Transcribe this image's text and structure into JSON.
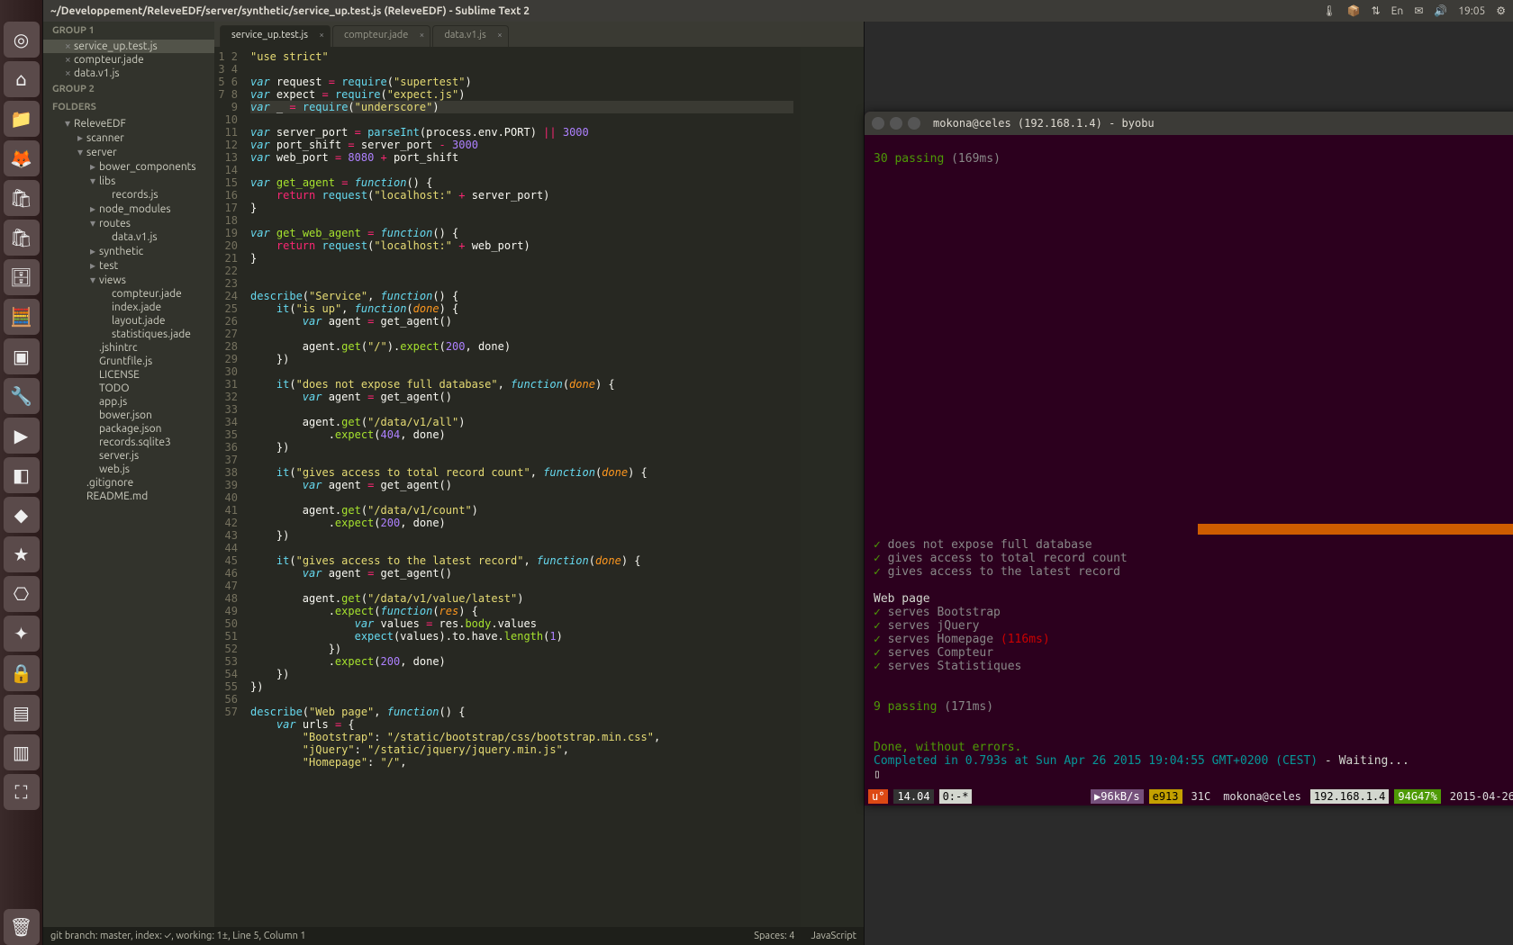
{
  "topbar": {
    "title": "~/Developpement/ReleveEDF/server/synthetic/service_up.test.js (ReleveEDF) - Sublime Text 2",
    "indicators": [
      "🌡",
      "📦",
      "⇅",
      "En",
      "✉",
      "🔊",
      "19:05",
      "⚙"
    ]
  },
  "launcher_icons": [
    "◎",
    "⌂",
    "📁",
    "🦊",
    "🛍",
    "🛍",
    "🗄",
    "🧮",
    "▣",
    "🔧",
    "▶",
    "◧",
    "◆",
    "★",
    "⎔",
    "✦",
    "🔒",
    "▤",
    "▥",
    "⛶"
  ],
  "sidebar": {
    "group1": "GROUP 1",
    "group1_items": [
      "service_up.test.js",
      "compteur.jade",
      "data.v1.js"
    ],
    "group2": "GROUP 2",
    "folders": "FOLDERS",
    "tree": [
      {
        "l": 1,
        "t": "ReleveEDF",
        "arrow": "▾"
      },
      {
        "l": 2,
        "t": "scanner",
        "arrow": "▸"
      },
      {
        "l": 2,
        "t": "server",
        "arrow": "▾"
      },
      {
        "l": 3,
        "t": "bower_components",
        "arrow": "▸"
      },
      {
        "l": 3,
        "t": "libs",
        "arrow": "▾"
      },
      {
        "l": 4,
        "t": "records.js"
      },
      {
        "l": 3,
        "t": "node_modules",
        "arrow": "▸"
      },
      {
        "l": 3,
        "t": "routes",
        "arrow": "▾"
      },
      {
        "l": 4,
        "t": "data.v1.js"
      },
      {
        "l": 3,
        "t": "synthetic",
        "arrow": "▸"
      },
      {
        "l": 3,
        "t": "test",
        "arrow": "▸"
      },
      {
        "l": 3,
        "t": "views",
        "arrow": "▾"
      },
      {
        "l": 4,
        "t": "compteur.jade"
      },
      {
        "l": 4,
        "t": "index.jade"
      },
      {
        "l": 4,
        "t": "layout.jade"
      },
      {
        "l": 4,
        "t": "statistiques.jade"
      },
      {
        "l": 3,
        "t": ".jshintrc"
      },
      {
        "l": 3,
        "t": "Gruntfile.js"
      },
      {
        "l": 3,
        "t": "LICENSE"
      },
      {
        "l": 3,
        "t": "TODO"
      },
      {
        "l": 3,
        "t": "app.js"
      },
      {
        "l": 3,
        "t": "bower.json"
      },
      {
        "l": 3,
        "t": "package.json"
      },
      {
        "l": 3,
        "t": "records.sqlite3"
      },
      {
        "l": 3,
        "t": "server.js"
      },
      {
        "l": 3,
        "t": "web.js"
      },
      {
        "l": 2,
        "t": ".gitignore"
      },
      {
        "l": 2,
        "t": "README.md"
      }
    ]
  },
  "tabs": [
    {
      "label": "service_up.test.js",
      "active": true
    },
    {
      "label": "compteur.jade",
      "active": false
    },
    {
      "label": "data.v1.js",
      "active": false
    }
  ],
  "code_lines": [
    "<span class='str'>\"use strict\"</span>",
    "",
    "<span class='kw'>var</span> request <span class='op'>=</span> <span class='builtin'>require</span>(<span class='str'>\"supertest\"</span>)",
    "<span class='kw'>var</span> expect <span class='op'>=</span> <span class='builtin'>require</span>(<span class='str'>\"expect.js\"</span>)",
    "<span class='kw'>var</span> _ <span class='op'>=</span> <span class='builtin'>require</span>(<span class='str'>\"underscore\"</span>)",
    "",
    "<span class='kw'>var</span> server_port <span class='op'>=</span> <span class='builtin'>parseInt</span>(process.env.PORT) <span class='op'>||</span> <span class='num'>3000</span>",
    "<span class='kw'>var</span> port_shift <span class='op'>=</span> server_port <span class='op'>-</span> <span class='num'>3000</span>",
    "<span class='kw'>var</span> web_port <span class='op'>=</span> <span class='num'>8080</span> <span class='op'>+</span> port_shift",
    "",
    "<span class='kw'>var</span> <span class='fn'>get_agent</span> <span class='op'>=</span> <span class='kw'>function</span>() {",
    "    <span class='kw2'>return</span> <span class='builtin'>request</span>(<span class='str'>\"localhost:\"</span> <span class='op'>+</span> server_port)",
    "}",
    "",
    "<span class='kw'>var</span> <span class='fn'>get_web_agent</span> <span class='op'>=</span> <span class='kw'>function</span>() {",
    "    <span class='kw2'>return</span> <span class='builtin'>request</span>(<span class='str'>\"localhost:\"</span> <span class='op'>+</span> web_port)",
    "}",
    "",
    "",
    "<span class='builtin'>describe</span>(<span class='str'>\"Service\"</span>, <span class='kw'>function</span>() {",
    "    <span class='builtin'>it</span>(<span class='str'>\"is up\"</span>, <span class='kw'>function</span>(<span class='param'>done</span>) {",
    "        <span class='kw'>var</span> agent <span class='op'>=</span> get_agent()",
    "",
    "        agent.<span class='fn'>get</span>(<span class='str'>\"/\"</span>).<span class='fn'>expect</span>(<span class='num'>200</span>, done)",
    "    })",
    "",
    "    <span class='builtin'>it</span>(<span class='str'>\"does not expose full database\"</span>, <span class='kw'>function</span>(<span class='param'>done</span>) {",
    "        <span class='kw'>var</span> agent <span class='op'>=</span> get_agent()",
    "",
    "        agent.<span class='fn'>get</span>(<span class='str'>\"/data/v1/all\"</span>)",
    "            .<span class='fn'>expect</span>(<span class='num'>404</span>, done)",
    "    })",
    "",
    "    <span class='builtin'>it</span>(<span class='str'>\"gives access to total record count\"</span>, <span class='kw'>function</span>(<span class='param'>done</span>) {",
    "        <span class='kw'>var</span> agent <span class='op'>=</span> get_agent()",
    "",
    "        agent.<span class='fn'>get</span>(<span class='str'>\"/data/v1/count\"</span>)",
    "            .<span class='fn'>expect</span>(<span class='num'>200</span>, done)",
    "    })",
    "",
    "    <span class='builtin'>it</span>(<span class='str'>\"gives access to the latest record\"</span>, <span class='kw'>function</span>(<span class='param'>done</span>) {",
    "        <span class='kw'>var</span> agent <span class='op'>=</span> get_agent()",
    "",
    "        agent.<span class='fn'>get</span>(<span class='str'>\"/data/v1/value/latest\"</span>)",
    "            .<span class='fn'>expect</span>(<span class='kw'>function</span>(<span class='param'>res</span>) {",
    "                <span class='kw'>var</span> values <span class='op'>=</span> res.<span class='prop'>body</span>.values",
    "                <span class='builtin'>expect</span>(values).to.have.<span class='fn'>length</span>(<span class='num'>1</span>)",
    "            })",
    "            .<span class='fn'>expect</span>(<span class='num'>200</span>, done)",
    "    })",
    "})",
    "",
    "<span class='builtin'>describe</span>(<span class='str'>\"Web page\"</span>, <span class='kw'>function</span>() {",
    "    <span class='kw'>var</span> urls <span class='op'>=</span> {",
    "        <span class='str'>\"Bootstrap\"</span>: <span class='str'>\"/static/bootstrap/css/bootstrap.min.css\"</span>,",
    "        <span class='str'>\"jQuery\"</span>: <span class='str'>\"/static/jquery/jquery.min.js\"</span>,",
    "        <span class='str'>\"Homepage\"</span>: <span class='str'>\"/\"</span>,"
  ],
  "statusbar": {
    "left": "git branch: master, index: ✓, working: 1±, Line 5, Column 1",
    "spaces": "Spaces: 4",
    "lang": "JavaScript"
  },
  "terminal": {
    "title": "mokona@celes (192.168.1.4) - byobu",
    "top_passing": "30 passing",
    "top_time": "(169ms)",
    "tests": [
      "does not expose full database",
      "gives access to total record count",
      "gives access to the latest record"
    ],
    "section": "Web page",
    "web_tests": [
      {
        "t": "serves Bootstrap",
        "slow": ""
      },
      {
        "t": "serves jQuery",
        "slow": ""
      },
      {
        "t": "serves Homepage",
        "slow": "(116ms)"
      },
      {
        "t": "serves Compteur",
        "slow": ""
      },
      {
        "t": "serves Statistiques",
        "slow": ""
      }
    ],
    "bottom_passing": "9 passing",
    "bottom_time": "(171ms)",
    "done": "Done, without errors.",
    "completed": "Completed in 0.793s at Sun Apr 26 2015 19:04:55 GMT+0200 (CEST)",
    "waiting": " - Waiting...",
    "cursor": "▯",
    "byobu": {
      "u": "u°",
      "ver": "14.04",
      "win": "0:-*",
      "net": "▶96kB/s",
      "e": "e913",
      "temp": "31C",
      "host": "mokona@celes",
      "ip": "192.168.1.4",
      "pct": "94G47%",
      "date": "2015-04-26"
    }
  }
}
